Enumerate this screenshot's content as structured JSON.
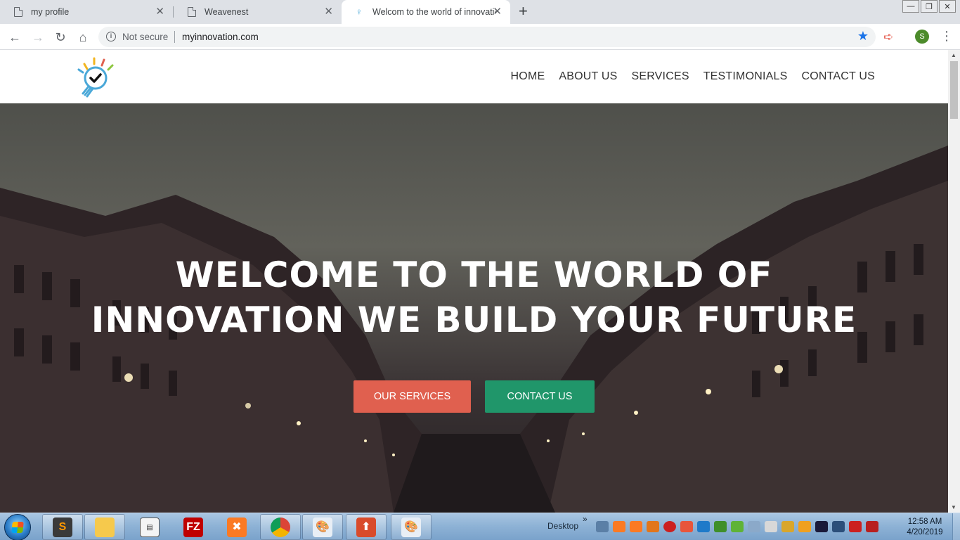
{
  "browser": {
    "tabs": [
      {
        "title": "my profile",
        "active": false
      },
      {
        "title": "Weavenest",
        "active": false
      },
      {
        "title": "Welcom to the world of innovatio",
        "active": true
      }
    ],
    "security_label": "Not secure",
    "url": "myinnovation.com",
    "profile_initial": "S",
    "accent_color": "#1a73e8"
  },
  "site": {
    "nav": [
      "HOME",
      "ABOUT US",
      "SERVICES",
      "TESTIMONIALS",
      "CONTACT US"
    ],
    "hero": {
      "title_line1": "WELCOME TO THE WORLD OF",
      "title_line2": "INNOVATION WE BUILD YOUR FUTURE",
      "primary_button": "OUR SERVICES",
      "secondary_button": "CONTACT US"
    },
    "colors": {
      "primary_button": "#e0604f",
      "secondary_button": "#20966a"
    }
  },
  "taskbar": {
    "desktop_label": "Desktop",
    "time": "12:58 AM",
    "date": "4/20/2019",
    "pinned": [
      "sublime-text",
      "file-explorer",
      "notepad",
      "filezilla",
      "xampp",
      "chrome",
      "paint",
      "uploader",
      "paint-2"
    ]
  }
}
